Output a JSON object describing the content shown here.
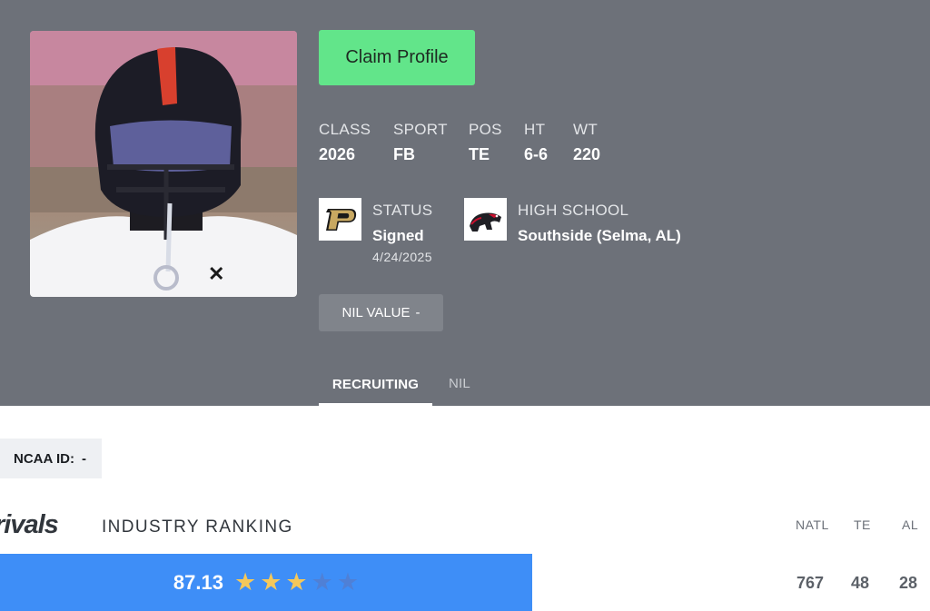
{
  "profile": {
    "claim_label": "Claim Profile",
    "stats": [
      {
        "label": "CLASS",
        "value": "2026"
      },
      {
        "label": "SPORT",
        "value": "FB"
      },
      {
        "label": "POS",
        "value": "TE"
      },
      {
        "label": "HT",
        "value": "6-6"
      },
      {
        "label": "WT",
        "value": "220"
      }
    ],
    "status": {
      "label": "STATUS",
      "value": "Signed",
      "date": "4/24/2025",
      "logo": "purdue-p-logo"
    },
    "high_school": {
      "label": "HIGH SCHOOL",
      "value": "Southside (Selma, AL)",
      "logo": "panther-logo"
    },
    "nil": {
      "label": "NIL VALUE",
      "value": "-"
    }
  },
  "tabs": [
    {
      "label": "RECRUITING",
      "active": true
    },
    {
      "label": "NIL",
      "active": false
    }
  ],
  "ncaa": {
    "label": "NCAA ID:",
    "value": "-"
  },
  "ranking": {
    "brand": "rivals",
    "title": "INDUSTRY RANKING",
    "rating": "87.13",
    "stars_filled": 3,
    "stars_total": 5,
    "columns": [
      {
        "label": "NATL",
        "value": "767"
      },
      {
        "label": "TE",
        "value": "48"
      },
      {
        "label": "AL",
        "value": "28"
      }
    ]
  },
  "colors": {
    "hero_bg": "#6d7179",
    "claim_bg": "#62e58a",
    "rating_bar": "#3e8ef7",
    "star_on": "#f5c85a"
  }
}
